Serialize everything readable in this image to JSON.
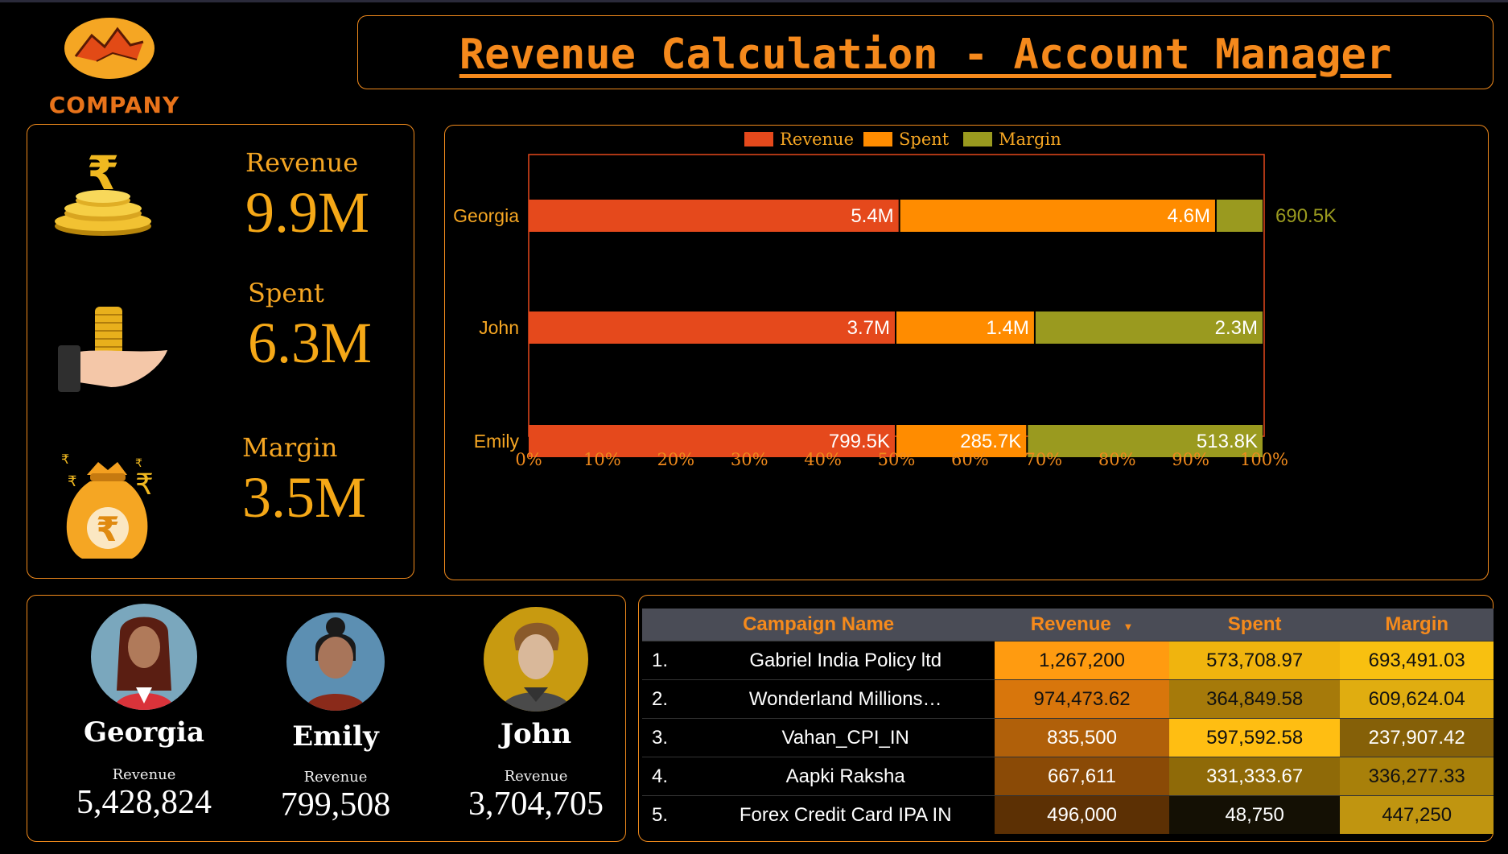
{
  "header": {
    "logo_text": "COMPANY",
    "title": "Revenue Calculation - Account Manager"
  },
  "kpis": [
    {
      "label": "Revenue",
      "value": "9.9M",
      "icon": "rupee-coin-stack-icon"
    },
    {
      "label": "Spent",
      "value": "6.3M",
      "icon": "hand-coins-icon"
    },
    {
      "label": "Margin",
      "value": "3.5M",
      "icon": "money-bag-icon"
    }
  ],
  "chart_data": {
    "type": "bar",
    "orientation": "horizontal",
    "stacked": "100%",
    "categories": [
      "Georgia",
      "John",
      "Emily"
    ],
    "series": [
      {
        "name": "Revenue",
        "color": "#e5491c",
        "values": [
          5400000,
          3700000,
          799500
        ],
        "labels": [
          "5.4M",
          "3.7M",
          "799.5K"
        ]
      },
      {
        "name": "Spent",
        "color": "#ff8c00",
        "values": [
          4600000,
          1400000,
          285700
        ],
        "labels": [
          "4.6M",
          "1.4M",
          "285.7K"
        ]
      },
      {
        "name": "Margin",
        "color": "#9a9a1f",
        "values": [
          690500,
          2300000,
          513800
        ],
        "labels": [
          "690.5K",
          "2.3M",
          "513.8K"
        ]
      }
    ],
    "xticks": [
      "0%",
      "10%",
      "20%",
      "30%",
      "40%",
      "50%",
      "60%",
      "70%",
      "80%",
      "90%",
      "100%"
    ],
    "xlim": [
      0,
      100
    ],
    "legend": "top"
  },
  "people": [
    {
      "name": "Georgia",
      "label": "Revenue",
      "value": "5,428,824",
      "bg": "#7aa7bd"
    },
    {
      "name": "Emily",
      "label": "Revenue",
      "value": "799,508",
      "bg": "#5c8fb2"
    },
    {
      "name": "John",
      "label": "Revenue",
      "value": "3,704,705",
      "bg": "#c89a10"
    }
  ],
  "table": {
    "headers": [
      "Campaign Name",
      "Revenue",
      "Spent",
      "Margin"
    ],
    "sort_indicator": "▼",
    "rows": [
      {
        "idx": "1.",
        "name": "Gabriel India Policy ltd",
        "revenue": "1,267,200",
        "spent": "573,708.97",
        "margin": "693,491.03",
        "colors": [
          "#ff9b10",
          "#f0b40e",
          "#f8c010"
        ]
      },
      {
        "idx": "2.",
        "name": "Wonderland Millions…",
        "revenue": "974,473.62",
        "spent": "364,849.58",
        "margin": "609,624.04",
        "colors": [
          "#d8760c",
          "#a67a0a",
          "#e0ad10"
        ]
      },
      {
        "idx": "3.",
        "name": "Vahan_CPI_IN",
        "revenue": "835,500",
        "spent": "597,592.58",
        "margin": "237,907.42",
        "colors": [
          "#b0600a",
          "#ffbe12",
          "#856008"
        ]
      },
      {
        "idx": "4.",
        "name": "Aapki Raksha",
        "revenue": "667,611",
        "spent": "331,333.67",
        "margin": "336,277.33",
        "colors": [
          "#8a4a06",
          "#8f6a08",
          "#a8800a"
        ]
      },
      {
        "idx": "5.",
        "name": "Forex Credit Card IPA IN",
        "revenue": "496,000",
        "spent": "48,750",
        "margin": "447,250",
        "colors": [
          "#5c3004",
          "#141004",
          "#c09510"
        ]
      }
    ]
  }
}
